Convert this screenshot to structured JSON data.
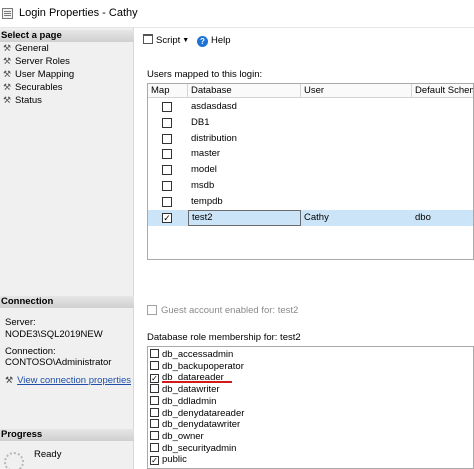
{
  "window": {
    "title": "Login Properties - Cathy"
  },
  "left_pane": {
    "select_page": {
      "heading": "Select a page",
      "items": [
        {
          "label": "General",
          "icon": "wrench-icon"
        },
        {
          "label": "Server Roles",
          "icon": "wrench-icon"
        },
        {
          "label": "User Mapping",
          "icon": "wrench-icon"
        },
        {
          "label": "Securables",
          "icon": "wrench-icon"
        },
        {
          "label": "Status",
          "icon": "wrench-icon"
        }
      ]
    },
    "connection": {
      "heading": "Connection",
      "server_label": "Server:",
      "server_value": "NODE3\\SQL2019NEW",
      "connection_label": "Connection:",
      "connection_value": "CONTOSO\\Administrator",
      "view_link": "View connection properties"
    },
    "progress": {
      "heading": "Progress",
      "status": "Ready"
    }
  },
  "toolbar": {
    "script_label": "Script",
    "help_label": "Help"
  },
  "users_mapped": {
    "label": "Users mapped to this login:",
    "columns": [
      "Map",
      "Database",
      "User",
      "Default Schema"
    ],
    "rows": [
      {
        "map": false,
        "database": "asdasdasd",
        "user": "",
        "schema": ""
      },
      {
        "map": false,
        "database": "DB1",
        "user": "",
        "schema": ""
      },
      {
        "map": false,
        "database": "distribution",
        "user": "",
        "schema": ""
      },
      {
        "map": false,
        "database": "master",
        "user": "",
        "schema": ""
      },
      {
        "map": false,
        "database": "model",
        "user": "",
        "schema": ""
      },
      {
        "map": false,
        "database": "msdb",
        "user": "",
        "schema": ""
      },
      {
        "map": false,
        "database": "tempdb",
        "user": "",
        "schema": ""
      },
      {
        "map": true,
        "database": "test2",
        "user": "Cathy",
        "schema": "dbo"
      }
    ],
    "selected_row": 7
  },
  "guest": {
    "label": "Guest account enabled for: test2",
    "checked": false
  },
  "role_membership": {
    "label": "Database role membership for: test2",
    "roles": [
      {
        "name": "db_accessadmin",
        "checked": false
      },
      {
        "name": "db_backupoperator",
        "checked": false
      },
      {
        "name": "db_datareader",
        "checked": true
      },
      {
        "name": "db_datawriter",
        "checked": false
      },
      {
        "name": "db_ddladmin",
        "checked": false
      },
      {
        "name": "db_denydatareader",
        "checked": false
      },
      {
        "name": "db_denydatawriter",
        "checked": false
      },
      {
        "name": "db_owner",
        "checked": false
      },
      {
        "name": "db_securityadmin",
        "checked": false
      },
      {
        "name": "public",
        "checked": true
      }
    ]
  },
  "colors": {
    "selection": "#cce4f7",
    "link": "#1f4fa8",
    "annotation_underline": "#d21a1a"
  }
}
